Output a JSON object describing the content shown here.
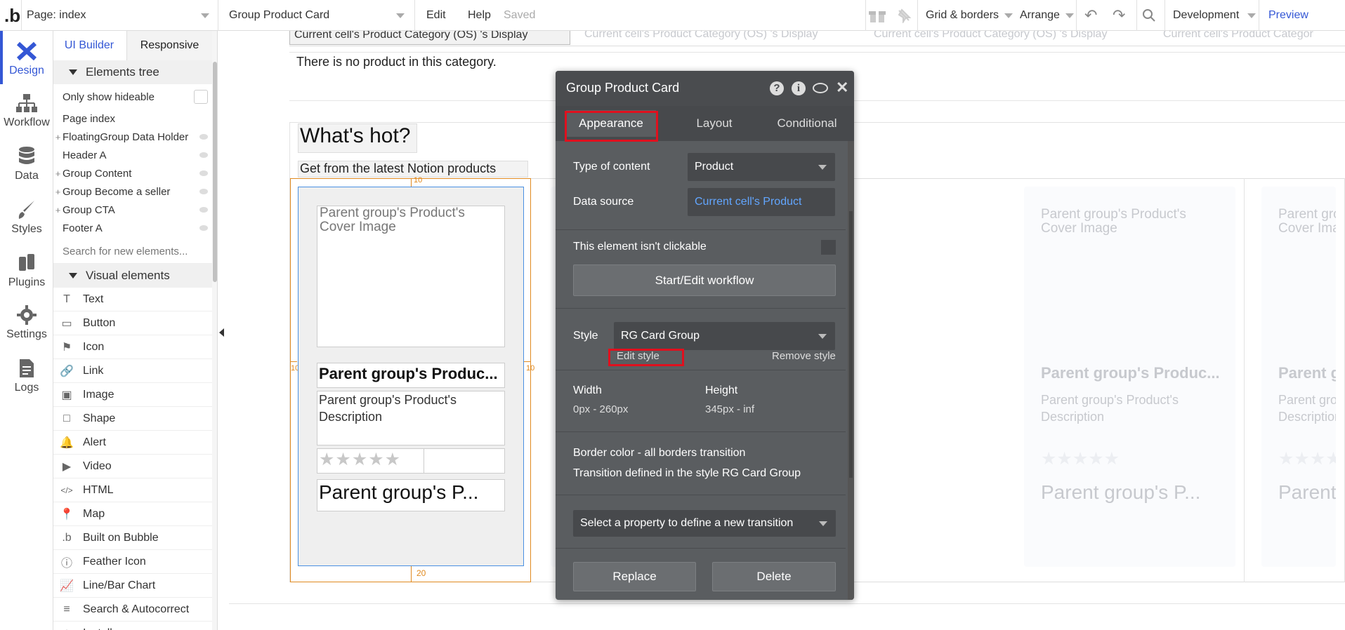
{
  "topbar": {
    "page_selector": "Page: index",
    "element_selector": "Group Product Card",
    "edit": "Edit",
    "help": "Help",
    "saved": "Saved",
    "grid_borders": "Grid & borders",
    "arrange": "Arrange",
    "environment": "Development",
    "preview": "Preview"
  },
  "leftnav": {
    "items": [
      {
        "label": "Design",
        "icon": "design-icon"
      },
      {
        "label": "Workflow",
        "icon": "workflow-icon"
      },
      {
        "label": "Data",
        "icon": "database-icon"
      },
      {
        "label": "Styles",
        "icon": "brush-icon"
      },
      {
        "label": "Plugins",
        "icon": "plugin-icon"
      },
      {
        "label": "Settings",
        "icon": "gear-icon"
      },
      {
        "label": "Logs",
        "icon": "document-icon"
      }
    ]
  },
  "panel": {
    "tabs": [
      "UI Builder",
      "Responsive"
    ],
    "elements_tree": "Elements tree",
    "only_show_hideable": "Only show hideable",
    "tree": [
      {
        "label": "Page index",
        "plus": false,
        "eye": false
      },
      {
        "label": "FloatingGroup Data Holder",
        "plus": true,
        "eye": true
      },
      {
        "label": "Header A",
        "plus": false,
        "eye": true
      },
      {
        "label": "Group Content",
        "plus": true,
        "eye": true
      },
      {
        "label": "Group Become a seller",
        "plus": true,
        "eye": true
      },
      {
        "label": "Group CTA",
        "plus": true,
        "eye": true
      },
      {
        "label": "Footer A",
        "plus": false,
        "eye": true
      }
    ],
    "search_placeholder": "Search for new elements...",
    "visual_elements": "Visual elements",
    "visual_items": [
      {
        "label": "Text",
        "icon": "T"
      },
      {
        "label": "Button",
        "icon": "▭"
      },
      {
        "label": "Icon",
        "icon": "⚑"
      },
      {
        "label": "Link",
        "icon": "🔗"
      },
      {
        "label": "Image",
        "icon": "▣"
      },
      {
        "label": "Shape",
        "icon": "□"
      },
      {
        "label": "Alert",
        "icon": "🔔"
      },
      {
        "label": "Video",
        "icon": "▶"
      },
      {
        "label": "HTML",
        "icon": "</>"
      },
      {
        "label": "Map",
        "icon": "📍"
      },
      {
        "label": "Built on Bubble",
        "icon": ".b"
      },
      {
        "label": "Feather Icon",
        "icon": "ⓘ"
      },
      {
        "label": "Line/Bar Chart",
        "icon": "📈"
      },
      {
        "label": "Search & Autocorrect",
        "icon": "≡"
      },
      {
        "label": "Install more...",
        "icon": "+"
      }
    ]
  },
  "canvas": {
    "top_cells": [
      "Current cell's Product Category (OS) 's Display",
      "Current cell's Product Category (OS) 's Display",
      "Current cell's Product Category (OS) 's Display",
      "Current cell's Product Categor"
    ],
    "no_product": "There is no product in this category.",
    "whats_hot": "What's hot?",
    "subtitle": "Get from the latest Notion products",
    "card_image": "Parent group's Product's Cover Image",
    "card_title": "Parent group's Produc...",
    "card_desc": "Parent group's Product's Description",
    "card_price": "Parent group's P...",
    "stars": "★★★★★",
    "dims": {
      "top": "10",
      "left": "10",
      "right": "10",
      "bottom": "20"
    }
  },
  "editor": {
    "title": "Group Product Card",
    "tabs": [
      "Appearance",
      "Layout",
      "Conditional"
    ],
    "type_of_content_label": "Type of content",
    "type_of_content_value": "Product",
    "data_source_label": "Data source",
    "data_source_value": "Current cell's Product",
    "not_clickable": "This element isn't clickable",
    "workflow_button": "Start/Edit workflow",
    "style_label": "Style",
    "style_value": "RG Card Group",
    "edit_style": "Edit style",
    "remove_style": "Remove style",
    "width_label": "Width",
    "width_value": "0px - 260px",
    "height_label": "Height",
    "height_value": "345px - inf",
    "border_transition": "Border color - all borders transition",
    "transition_defined": "Transition defined in the style RG Card Group",
    "new_transition": "Select a property to define a new transition",
    "replace": "Replace",
    "delete": "Delete"
  },
  "colors": {
    "accent": "#3457d5",
    "highlight": "#e0101e",
    "editor_bg": "#5a5d60",
    "link": "#62a6ff"
  }
}
